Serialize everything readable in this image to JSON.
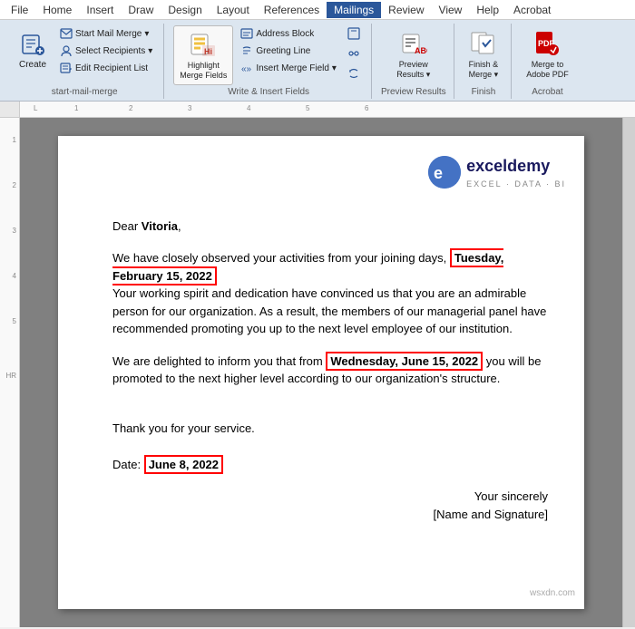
{
  "menu": {
    "items": [
      {
        "label": "File",
        "active": false
      },
      {
        "label": "Home",
        "active": false
      },
      {
        "label": "Insert",
        "active": false
      },
      {
        "label": "Draw",
        "active": false
      },
      {
        "label": "Design",
        "active": false
      },
      {
        "label": "Layout",
        "active": false
      },
      {
        "label": "References",
        "active": false
      },
      {
        "label": "Mailings",
        "active": true
      },
      {
        "label": "Review",
        "active": false
      },
      {
        "label": "View",
        "active": false
      },
      {
        "label": "Help",
        "active": false
      },
      {
        "label": "Acrobat",
        "active": false
      }
    ]
  },
  "ribbon": {
    "groups": [
      {
        "name": "start-mail-merge",
        "label": "Start Mail Merge",
        "buttons": [
          {
            "id": "create",
            "label": "Create",
            "icon": "📧",
            "type": "large"
          },
          {
            "id": "start-mail-merge",
            "label": "Start Mail Merge",
            "icon": "📋",
            "type": "small",
            "hasDropdown": true
          },
          {
            "id": "select-recipients",
            "label": "Select Recipients",
            "icon": "👥",
            "type": "small",
            "hasDropdown": true
          },
          {
            "id": "edit-recipient-list",
            "label": "Edit Recipient List",
            "icon": "📝",
            "type": "small"
          }
        ]
      },
      {
        "name": "write-insert-fields",
        "label": "Write & Insert Fields",
        "buttons": [
          {
            "id": "highlight-merge-fields",
            "label": "Highlight\nMerge Fields",
            "icon": "🖊",
            "type": "large-with-underline"
          },
          {
            "id": "address-block",
            "label": "Address Block",
            "icon": "📮",
            "type": "small"
          },
          {
            "id": "greeting-line",
            "label": "Greeting Line",
            "icon": "👋",
            "type": "small"
          },
          {
            "id": "insert-merge-field",
            "label": "Insert Merge Field",
            "icon": "⚡",
            "type": "small",
            "hasDropdown": true
          },
          {
            "id": "rules",
            "label": "Rules",
            "icon": "📏",
            "type": "small-col"
          },
          {
            "id": "match-fields",
            "label": "Match Fields",
            "icon": "🔗",
            "type": "small-col"
          },
          {
            "id": "update-labels",
            "label": "Update Labels",
            "icon": "🔄",
            "type": "small-col"
          }
        ]
      },
      {
        "name": "preview-results",
        "label": "Preview Results",
        "buttons": [
          {
            "id": "preview-results",
            "label": "Preview\nResults",
            "icon": "👁",
            "type": "large",
            "hasDropdown": true
          }
        ]
      },
      {
        "name": "finish",
        "label": "Finish",
        "buttons": [
          {
            "id": "finish-merge",
            "label": "Finish &\nMerge",
            "icon": "✅",
            "type": "large",
            "hasDropdown": true
          }
        ]
      },
      {
        "name": "acrobat",
        "label": "Acrobat",
        "buttons": [
          {
            "id": "merge-to-pdf",
            "label": "Merge to\nAdobe PDF",
            "icon": "📄",
            "type": "large"
          }
        ]
      }
    ]
  },
  "letter": {
    "greeting": "Dear ",
    "name": "Vitoria",
    "greeting_comma": ",",
    "para1_before": "We have closely observed your activities from your joining days, ",
    "date1": "Tuesday, February 15, 2022",
    "para1_after": "\nYour working spirit and dedication have convinced us that you are an admirable person for our organization. As a result, the members of our managerial panel have recommended promoting you up to the next level employee of our institution.",
    "para2_before": "We are delighted to inform you that from ",
    "date2": "Wednesday, June 15, 2022",
    "para2_after": " you will be promoted to the next higher level according to our organization's structure.",
    "thanks": "Thank you for your service.",
    "date_label": "Date: ",
    "date3": "June 8, 2022",
    "sign1": "Your sincerely",
    "sign2": "[Name and Signature]",
    "watermark": "wsxdn.com"
  },
  "logo": {
    "icon_letter": "e",
    "main": "exceldemy",
    "sub": "EXCEL · DATA · BI"
  }
}
